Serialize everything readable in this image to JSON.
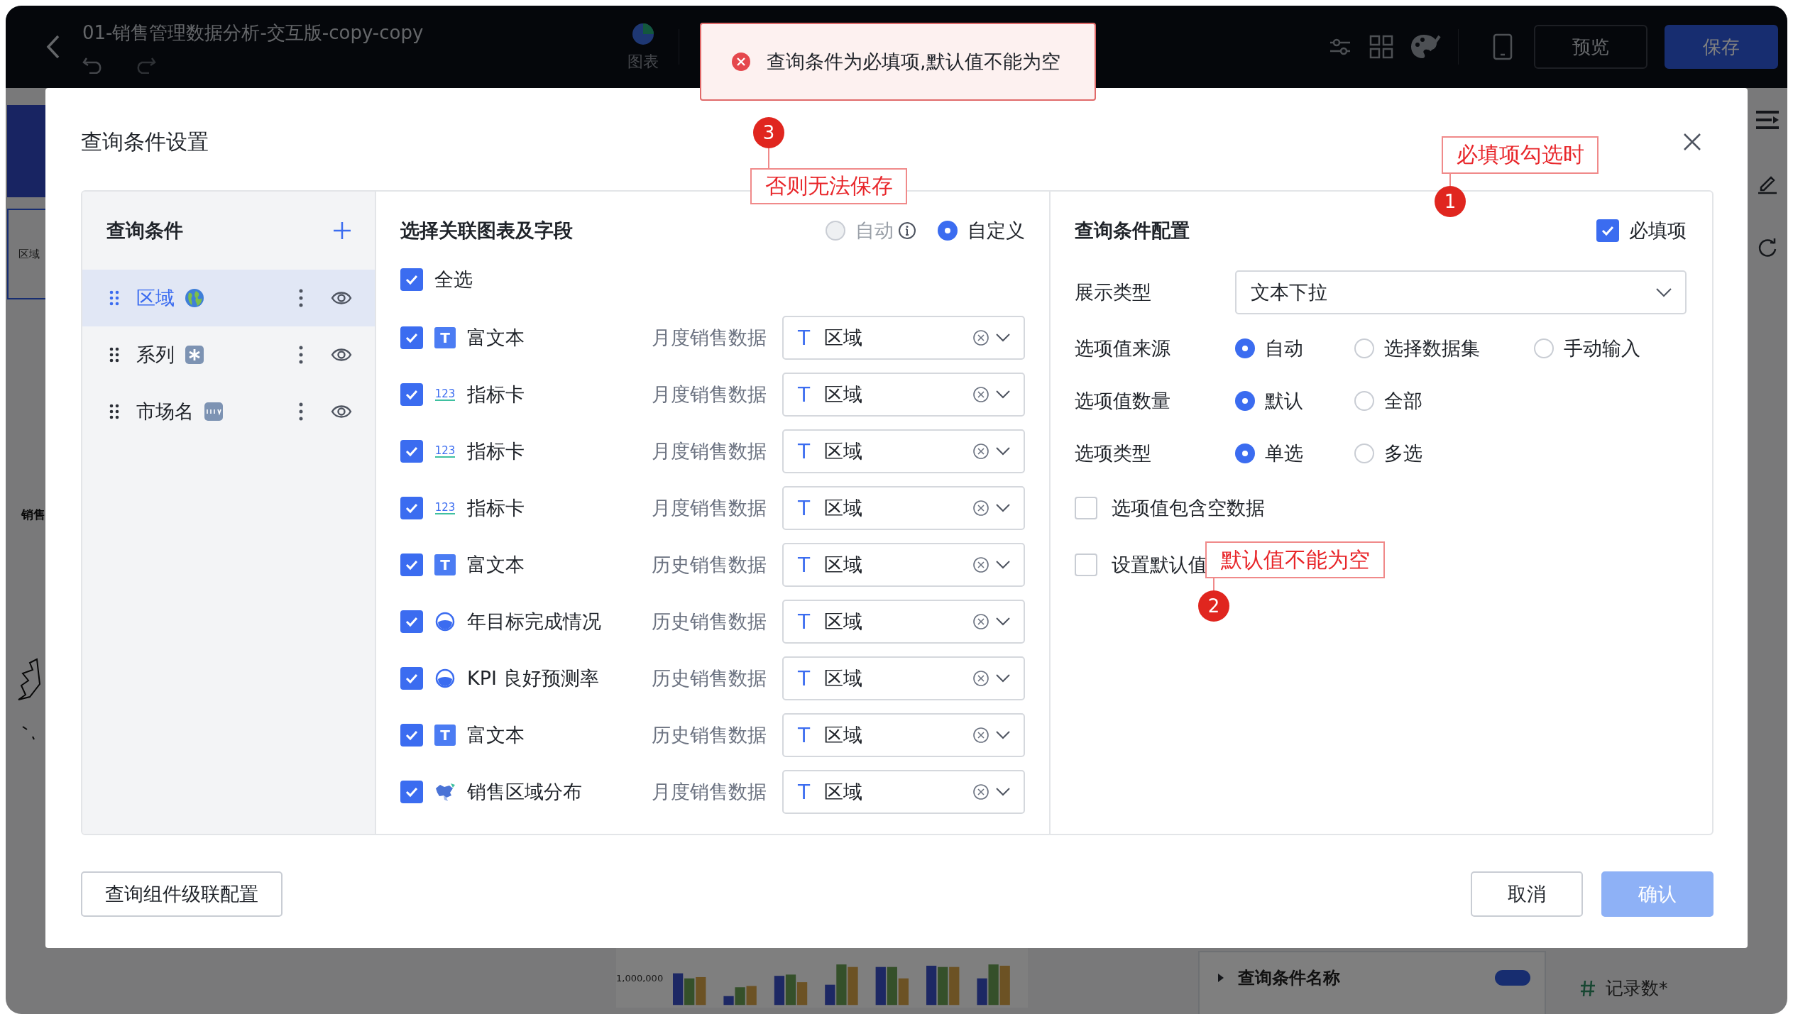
{
  "topbar": {
    "title": "01-销售管理数据分析-交互版-copy-copy",
    "tool_label": "图表",
    "buttons": [
      {
        "label": "预览",
        "kind": "secondary"
      },
      {
        "label": "保存",
        "kind": "primary"
      }
    ]
  },
  "toast": {
    "message": "查询条件为必填项,默认值不能为空"
  },
  "background": {
    "canvas_label": "区域",
    "chart_title": "销售",
    "ytick": "1,000,000",
    "panel_item": "查询条件名称",
    "toggle_on": true,
    "field_item": "记录数*"
  },
  "dialog": {
    "title": "查询条件设置",
    "conditions": {
      "title": "查询条件",
      "items": [
        {
          "label": "区域",
          "kind": "globe",
          "selected": true
        },
        {
          "label": "系列",
          "kind": "asterisk",
          "selected": false
        },
        {
          "label": "市场名",
          "kind": "new",
          "selected": false
        }
      ]
    },
    "linked": {
      "title": "选择关联图表及字段",
      "modes": [
        {
          "label": "自动",
          "selected": false,
          "disabled": true,
          "info": true
        },
        {
          "label": "自定义",
          "selected": true,
          "disabled": false,
          "info": false
        }
      ],
      "select_all": {
        "label": "全选",
        "checked": true
      },
      "rows": [
        {
          "checked": true,
          "kind": "text",
          "icon_text": "T",
          "chart": "富文本",
          "dataset": "月度销售数据",
          "field_type": "T",
          "field": "区域"
        },
        {
          "checked": true,
          "kind": "indicator",
          "icon_text": "123",
          "chart": "指标卡",
          "dataset": "月度销售数据",
          "field_type": "T",
          "field": "区域"
        },
        {
          "checked": true,
          "kind": "indicator",
          "icon_text": "123",
          "chart": "指标卡",
          "dataset": "月度销售数据",
          "field_type": "T",
          "field": "区域"
        },
        {
          "checked": true,
          "kind": "indicator",
          "icon_text": "123",
          "chart": "指标卡",
          "dataset": "月度销售数据",
          "field_type": "T",
          "field": "区域"
        },
        {
          "checked": true,
          "kind": "text",
          "icon_text": "T",
          "chart": "富文本",
          "dataset": "历史销售数据",
          "field_type": "T",
          "field": "区域"
        },
        {
          "checked": true,
          "kind": "gauge",
          "chart": "年目标完成情况",
          "dataset": "历史销售数据",
          "field_type": "T",
          "field": "区域"
        },
        {
          "checked": true,
          "kind": "gauge",
          "chart": "KPI 良好预测率",
          "dataset": "历史销售数据",
          "field_type": "T",
          "field": "区域"
        },
        {
          "checked": true,
          "kind": "text",
          "icon_text": "T",
          "chart": "富文本",
          "dataset": "历史销售数据",
          "field_type": "T",
          "field": "区域"
        },
        {
          "checked": true,
          "kind": "map",
          "chart": "销售区域分布",
          "dataset": "月度销售数据",
          "field_type": "T",
          "field": "区域"
        }
      ]
    },
    "config": {
      "title": "查询条件配置",
      "required": {
        "label": "必填项",
        "checked": true
      },
      "display_type": {
        "label": "展示类型",
        "value": "文本下拉"
      },
      "radio_groups": [
        {
          "label": "选项值来源",
          "options": [
            {
              "label": "自动",
              "selected": true
            },
            {
              "label": "选择数据集",
              "selected": false
            },
            {
              "label": "手动输入",
              "selected": false
            }
          ]
        },
        {
          "label": "选项值数量",
          "options": [
            {
              "label": "默认",
              "selected": true
            },
            {
              "label": "全部",
              "selected": false
            }
          ]
        },
        {
          "label": "选项类型",
          "options": [
            {
              "label": "单选",
              "selected": true
            },
            {
              "label": "多选",
              "selected": false
            }
          ]
        }
      ],
      "checkboxes": [
        {
          "label": "选项值包含空数据",
          "checked": false
        },
        {
          "label": "设置默认值",
          "checked": false
        }
      ]
    },
    "footer": {
      "cascade": "查询组件级联配置",
      "cancel": "取消",
      "confirm": "确认"
    }
  },
  "annotations": [
    {
      "number": "1",
      "text": "必填项勾选时"
    },
    {
      "number": "2",
      "text": "默认值不能为空"
    },
    {
      "number": "3",
      "text": "否则无法保存"
    }
  ]
}
